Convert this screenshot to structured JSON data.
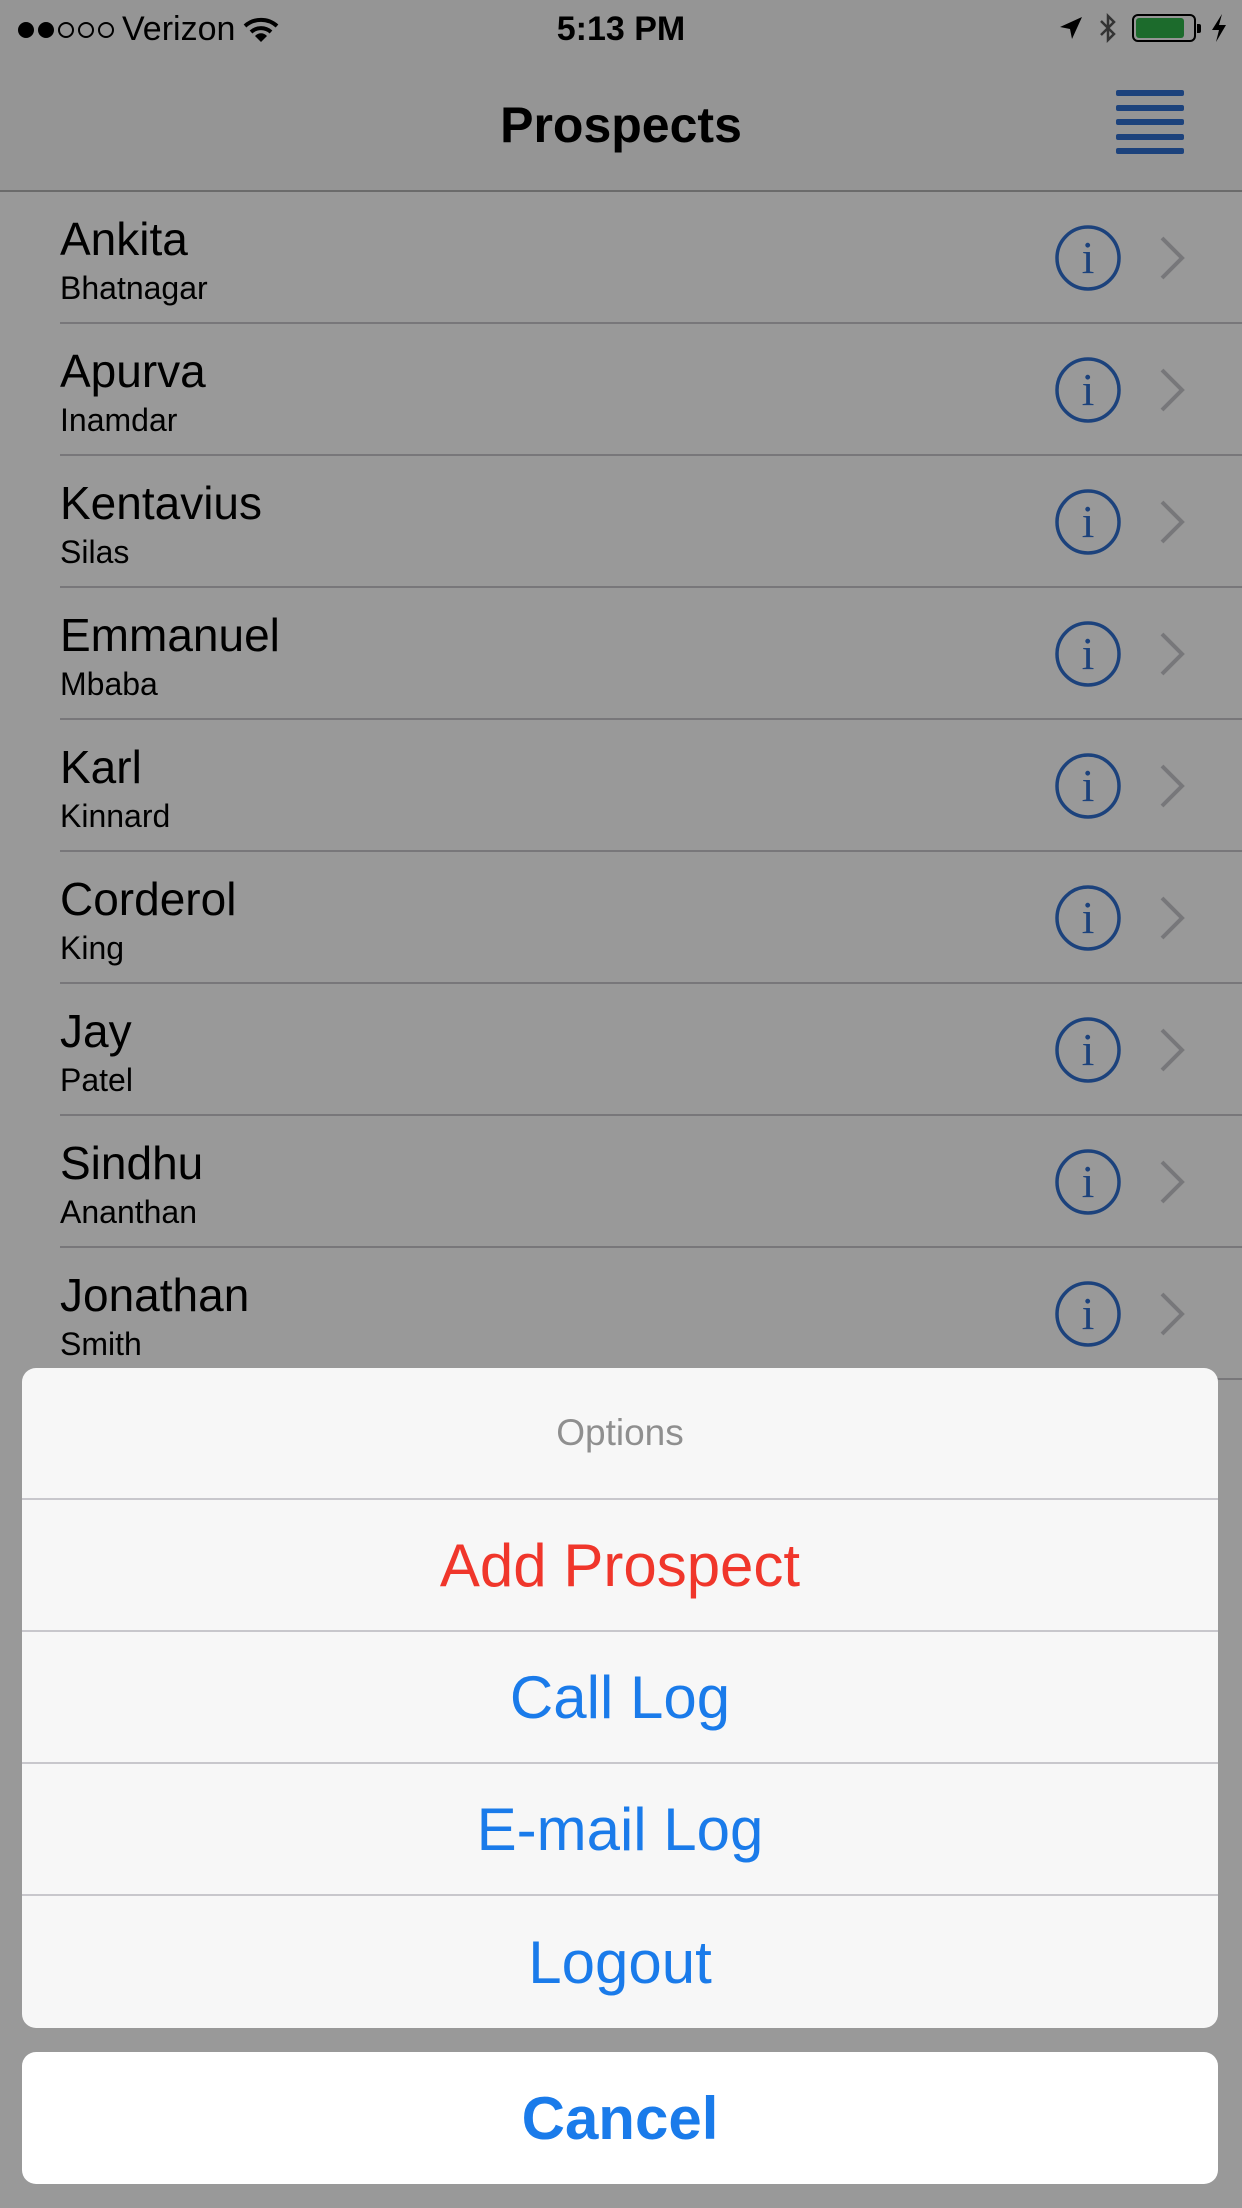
{
  "status_bar": {
    "carrier": "Verizon",
    "time": "5:13 PM",
    "signal_bars_filled": 2,
    "signal_bars_total": 5,
    "battery_level": 0.85,
    "icons": [
      "wifi-icon",
      "location-arrow-icon",
      "bluetooth-icon",
      "battery-icon",
      "charging-bolt-icon"
    ]
  },
  "nav_bar": {
    "title": "Prospects",
    "right_button_icon": "hamburger-menu-icon"
  },
  "prospects": [
    {
      "first": "Ankita",
      "last": "Bhatnagar"
    },
    {
      "first": "Apurva",
      "last": "Inamdar"
    },
    {
      "first": "Kentavius",
      "last": "Silas"
    },
    {
      "first": "Emmanuel",
      "last": "Mbaba"
    },
    {
      "first": "Karl",
      "last": "Kinnard"
    },
    {
      "first": "Corderol",
      "last": "King"
    },
    {
      "first": "Jay",
      "last": "Patel"
    },
    {
      "first": "Sindhu",
      "last": "Ananthan"
    },
    {
      "first": "Jonathan",
      "last": "Smith"
    }
  ],
  "action_sheet": {
    "title": "Options",
    "items": [
      {
        "label": "Add Prospect",
        "style": "destructive"
      },
      {
        "label": "Call Log",
        "style": "default"
      },
      {
        "label": "E-mail Log",
        "style": "default"
      },
      {
        "label": "Logout",
        "style": "default"
      }
    ],
    "cancel_label": "Cancel"
  },
  "colors": {
    "tint": "#1a7bea",
    "destructive": "#f0362b",
    "info_icon": "#2f6fcf",
    "battery": "#2fb24a"
  }
}
